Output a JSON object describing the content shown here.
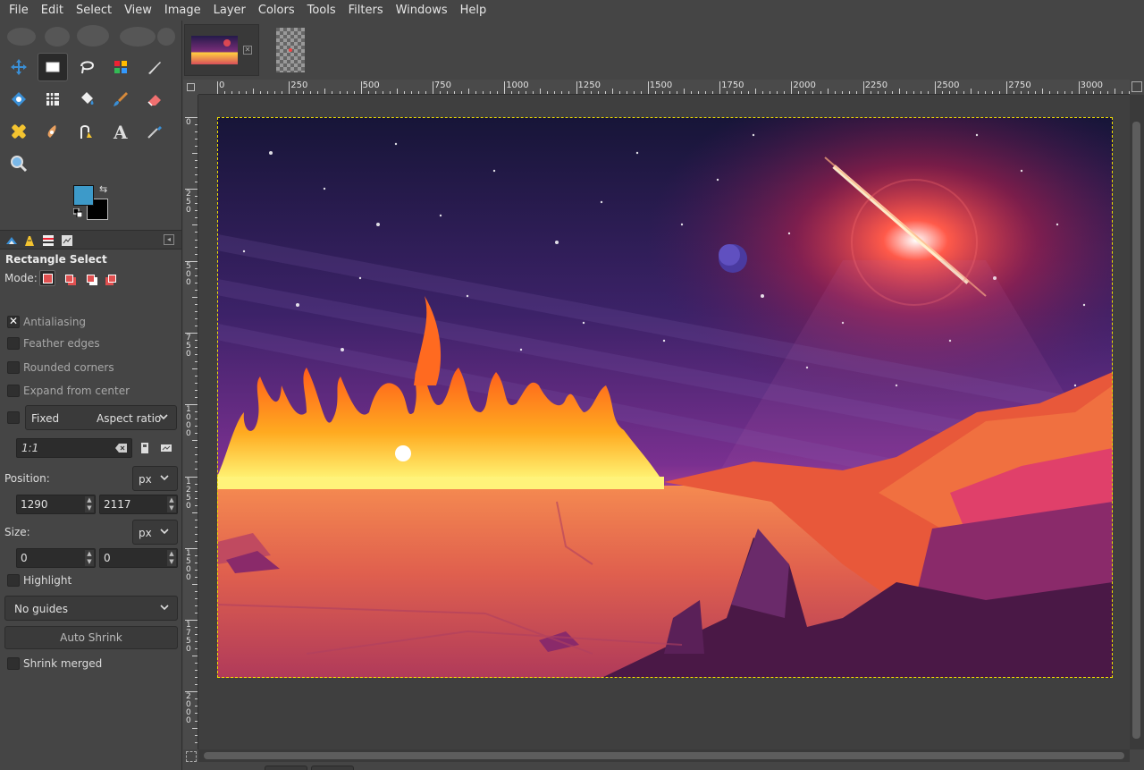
{
  "menu": [
    "File",
    "Edit",
    "Select",
    "View",
    "Image",
    "Layer",
    "Colors",
    "Tools",
    "Filters",
    "Windows",
    "Help"
  ],
  "toolbox": {
    "tools": [
      "move-tool",
      "rect-select-tool",
      "free-select-tool",
      "fuzzy-select-tool",
      "paths-tool",
      "transform-tool",
      "warp-tool",
      "bucket-fill-tool",
      "paintbrush-tool",
      "eraser-tool",
      "heal-tool",
      "smudge-tool",
      "paths-pen-tool",
      "text-tool",
      "color-picker-tool",
      "zoom-tool"
    ],
    "foreground_color": "#3d9ac9",
    "background_color": "#000000"
  },
  "tool_options": {
    "title": "Rectangle Select",
    "mode_label": "Mode:",
    "antialiasing": "Antialiasing",
    "feather_edges": "Feather edges",
    "rounded_corners": "Rounded corners",
    "expand_from_center": "Expand from center",
    "fixed": "Fixed",
    "fixed_mode": "Aspect ratio",
    "ratio": "1:1",
    "position_label": "Position:",
    "position_unit": "px",
    "position_x": "1290",
    "position_y": "2117",
    "size_label": "Size:",
    "size_unit": "px",
    "size_w": "0",
    "size_h": "0",
    "highlight": "Highlight",
    "guides": "No guides",
    "auto_shrink": "Auto Shrink",
    "shrink_merged": "Shrink merged",
    "checked": {
      "antialiasing": true,
      "feather_edges": false,
      "rounded_corners": false,
      "expand_from_center": false,
      "fixed": false,
      "highlight": false,
      "shrink_merged": false
    }
  },
  "rulers": {
    "h_labels": [
      "0",
      "250",
      "500",
      "750",
      "1000",
      "1250",
      "1500",
      "1750",
      "2000",
      "2250",
      "2500",
      "2750",
      "3000"
    ],
    "v_labels": [
      "0",
      "250",
      "500",
      "750",
      "1000",
      "1250",
      "1500",
      "1750",
      "2000"
    ]
  },
  "colors": {
    "ui_bg": "#454545",
    "selection": "#f0e000",
    "sky_top": "#1a1640",
    "sky_mid": "#4a2470",
    "ground": "#e8604a"
  }
}
